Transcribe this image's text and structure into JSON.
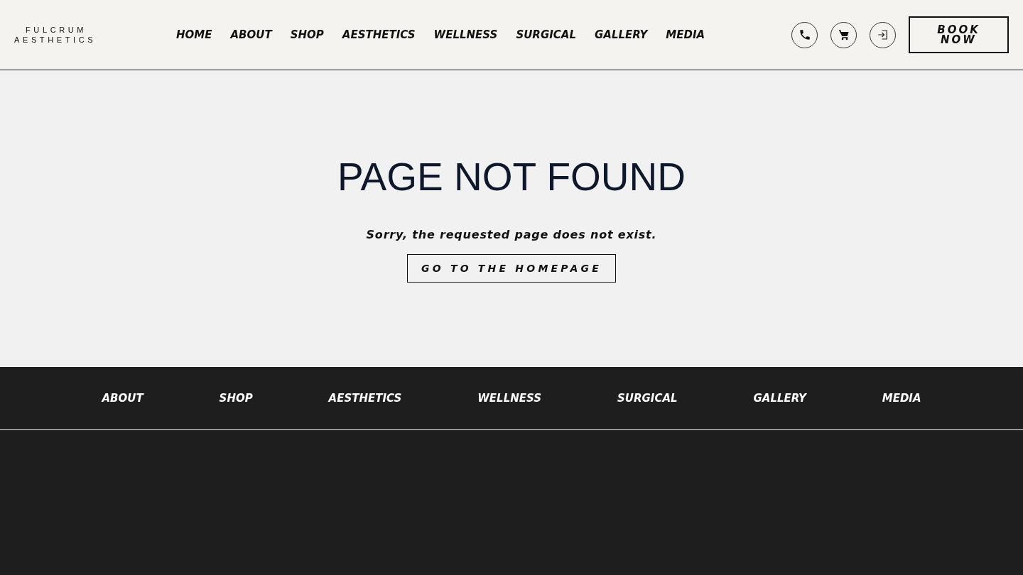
{
  "logo": {
    "line_1": "FULCRUM",
    "line_2": "AESTHETICS"
  },
  "nav": [
    "HOME",
    "ABOUT",
    "SHOP",
    "AESTHETICS",
    "WELLNESS",
    "SURGICAL",
    "GALLERY",
    "MEDIA"
  ],
  "header_actions": {
    "book_button": "BOOK NOW"
  },
  "main": {
    "title": "PAGE NOT FOUND",
    "message": "Sorry, the requested page does not exist.",
    "button": "GO TO THE HOMEPAGE"
  },
  "footer_nav": [
    "ABOUT",
    "SHOP",
    "AESTHETICS",
    "WELLNESS",
    "SURGICAL",
    "GALLERY",
    "MEDIA"
  ]
}
